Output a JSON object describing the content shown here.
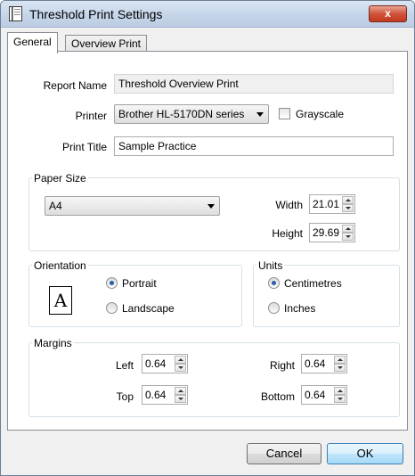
{
  "window": {
    "title": "Threshold Print Settings",
    "close_label": "x"
  },
  "tabs": [
    {
      "label": "General",
      "active": true
    },
    {
      "label": "Overview Print",
      "active": false
    }
  ],
  "report": {
    "name_label": "Report Name",
    "name_value": "Threshold Overview Print",
    "printer_label": "Printer",
    "printer_value": "Brother HL-5170DN series",
    "grayscale_label": "Grayscale",
    "grayscale_checked": false,
    "title_label": "Print Title",
    "title_value": "Sample Practice"
  },
  "paper": {
    "group_label": "Paper Size",
    "size_value": "A4",
    "width_label": "Width",
    "width_value": "21.01",
    "height_label": "Height",
    "height_value": "29.69"
  },
  "orientation": {
    "group_label": "Orientation",
    "icon_glyph": "A",
    "portrait_label": "Portrait",
    "landscape_label": "Landscape",
    "selected": "Portrait"
  },
  "units": {
    "group_label": "Units",
    "cm_label": "Centimetres",
    "inches_label": "Inches",
    "selected": "Centimetres"
  },
  "margins": {
    "group_label": "Margins",
    "left_label": "Left",
    "left_value": "0.64",
    "right_label": "Right",
    "right_value": "0.64",
    "top_label": "Top",
    "top_value": "0.64",
    "bottom_label": "Bottom",
    "bottom_value": "0.64"
  },
  "buttons": {
    "cancel_label": "Cancel",
    "ok_label": "OK"
  },
  "colors": {
    "close_button": "#c94a2e",
    "radio_selected": "#2b5fa8",
    "ok_border": "#3c7fb1"
  }
}
